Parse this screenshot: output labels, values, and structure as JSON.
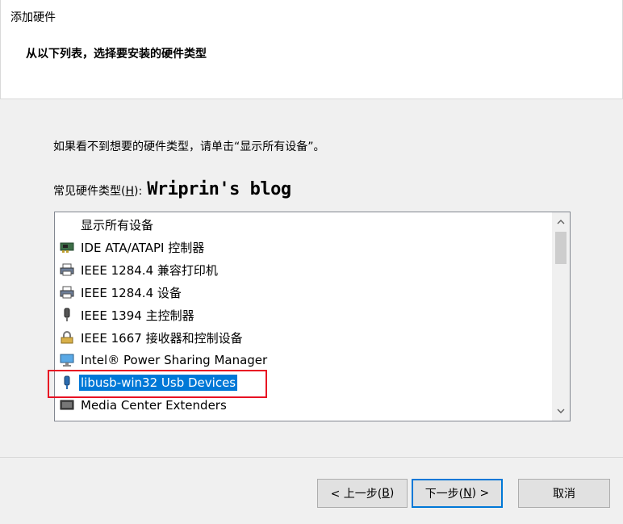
{
  "window": {
    "title": "添加硬件"
  },
  "header": {
    "subtitle": "从以下列表，选择要安装的硬件类型"
  },
  "instruction": "如果看不到想要的硬件类型，请单击“显示所有设备”。",
  "hardware_label": {
    "text": "常见硬件类型(",
    "hotkey": "H",
    "suffix": "):"
  },
  "watermark": "Wriprin's blog",
  "list": {
    "items": [
      {
        "label": "显示所有设备",
        "icon": "none"
      },
      {
        "label": "IDE ATA/ATAPI 控制器",
        "icon": "ide-controller-icon"
      },
      {
        "label": "IEEE 1284.4 兼容打印机",
        "icon": "printer-icon"
      },
      {
        "label": "IEEE 1284.4 设备",
        "icon": "printer-icon"
      },
      {
        "label": "IEEE 1394 主控制器",
        "icon": "firewire-icon"
      },
      {
        "label": "IEEE 1667 接收器和控制设备",
        "icon": "security-device-icon"
      },
      {
        "label": "Intel® Power Sharing Manager",
        "icon": "monitor-icon"
      },
      {
        "label": "libusb-win32 Usb Devices",
        "icon": "usb-icon",
        "selected": true
      },
      {
        "label": "Media Center Extenders",
        "icon": "media-center-icon"
      }
    ]
  },
  "buttons": {
    "back": {
      "prefix": "< 上一步(",
      "hotkey": "B",
      "suffix": ")"
    },
    "next": {
      "prefix": "下一步(",
      "hotkey": "N",
      "suffix": ") >"
    },
    "cancel": {
      "label": "取消"
    }
  },
  "colors": {
    "selection": "#0078d7",
    "highlight_box": "#e81123",
    "primary_button_border": "#0078d7"
  }
}
